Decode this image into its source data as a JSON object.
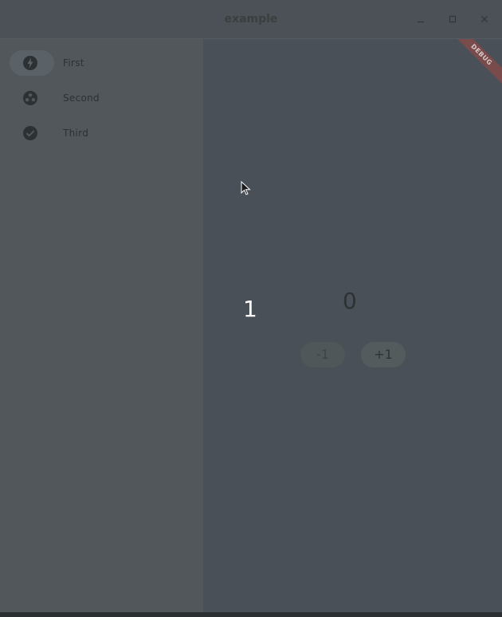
{
  "window": {
    "title": "example",
    "controls": [
      "minimize-icon",
      "maximize-icon",
      "close-icon"
    ]
  },
  "sidebar": {
    "items": [
      {
        "label": "First",
        "icon": "flash-icon",
        "selected": true
      },
      {
        "label": "Second",
        "icon": "soccer-ball-icon",
        "selected": false
      },
      {
        "label": "Third",
        "icon": "check-circle-icon",
        "selected": false
      }
    ]
  },
  "content": {
    "banner": "DEBUG",
    "page_index_label": "1",
    "counter_value": "0",
    "decrement_label": "-1",
    "increment_label": "+1"
  },
  "colors": {
    "sidebar_bg": "#52575b",
    "content_bg": "#4a5057",
    "titlebar_bg": "#4c5157"
  }
}
